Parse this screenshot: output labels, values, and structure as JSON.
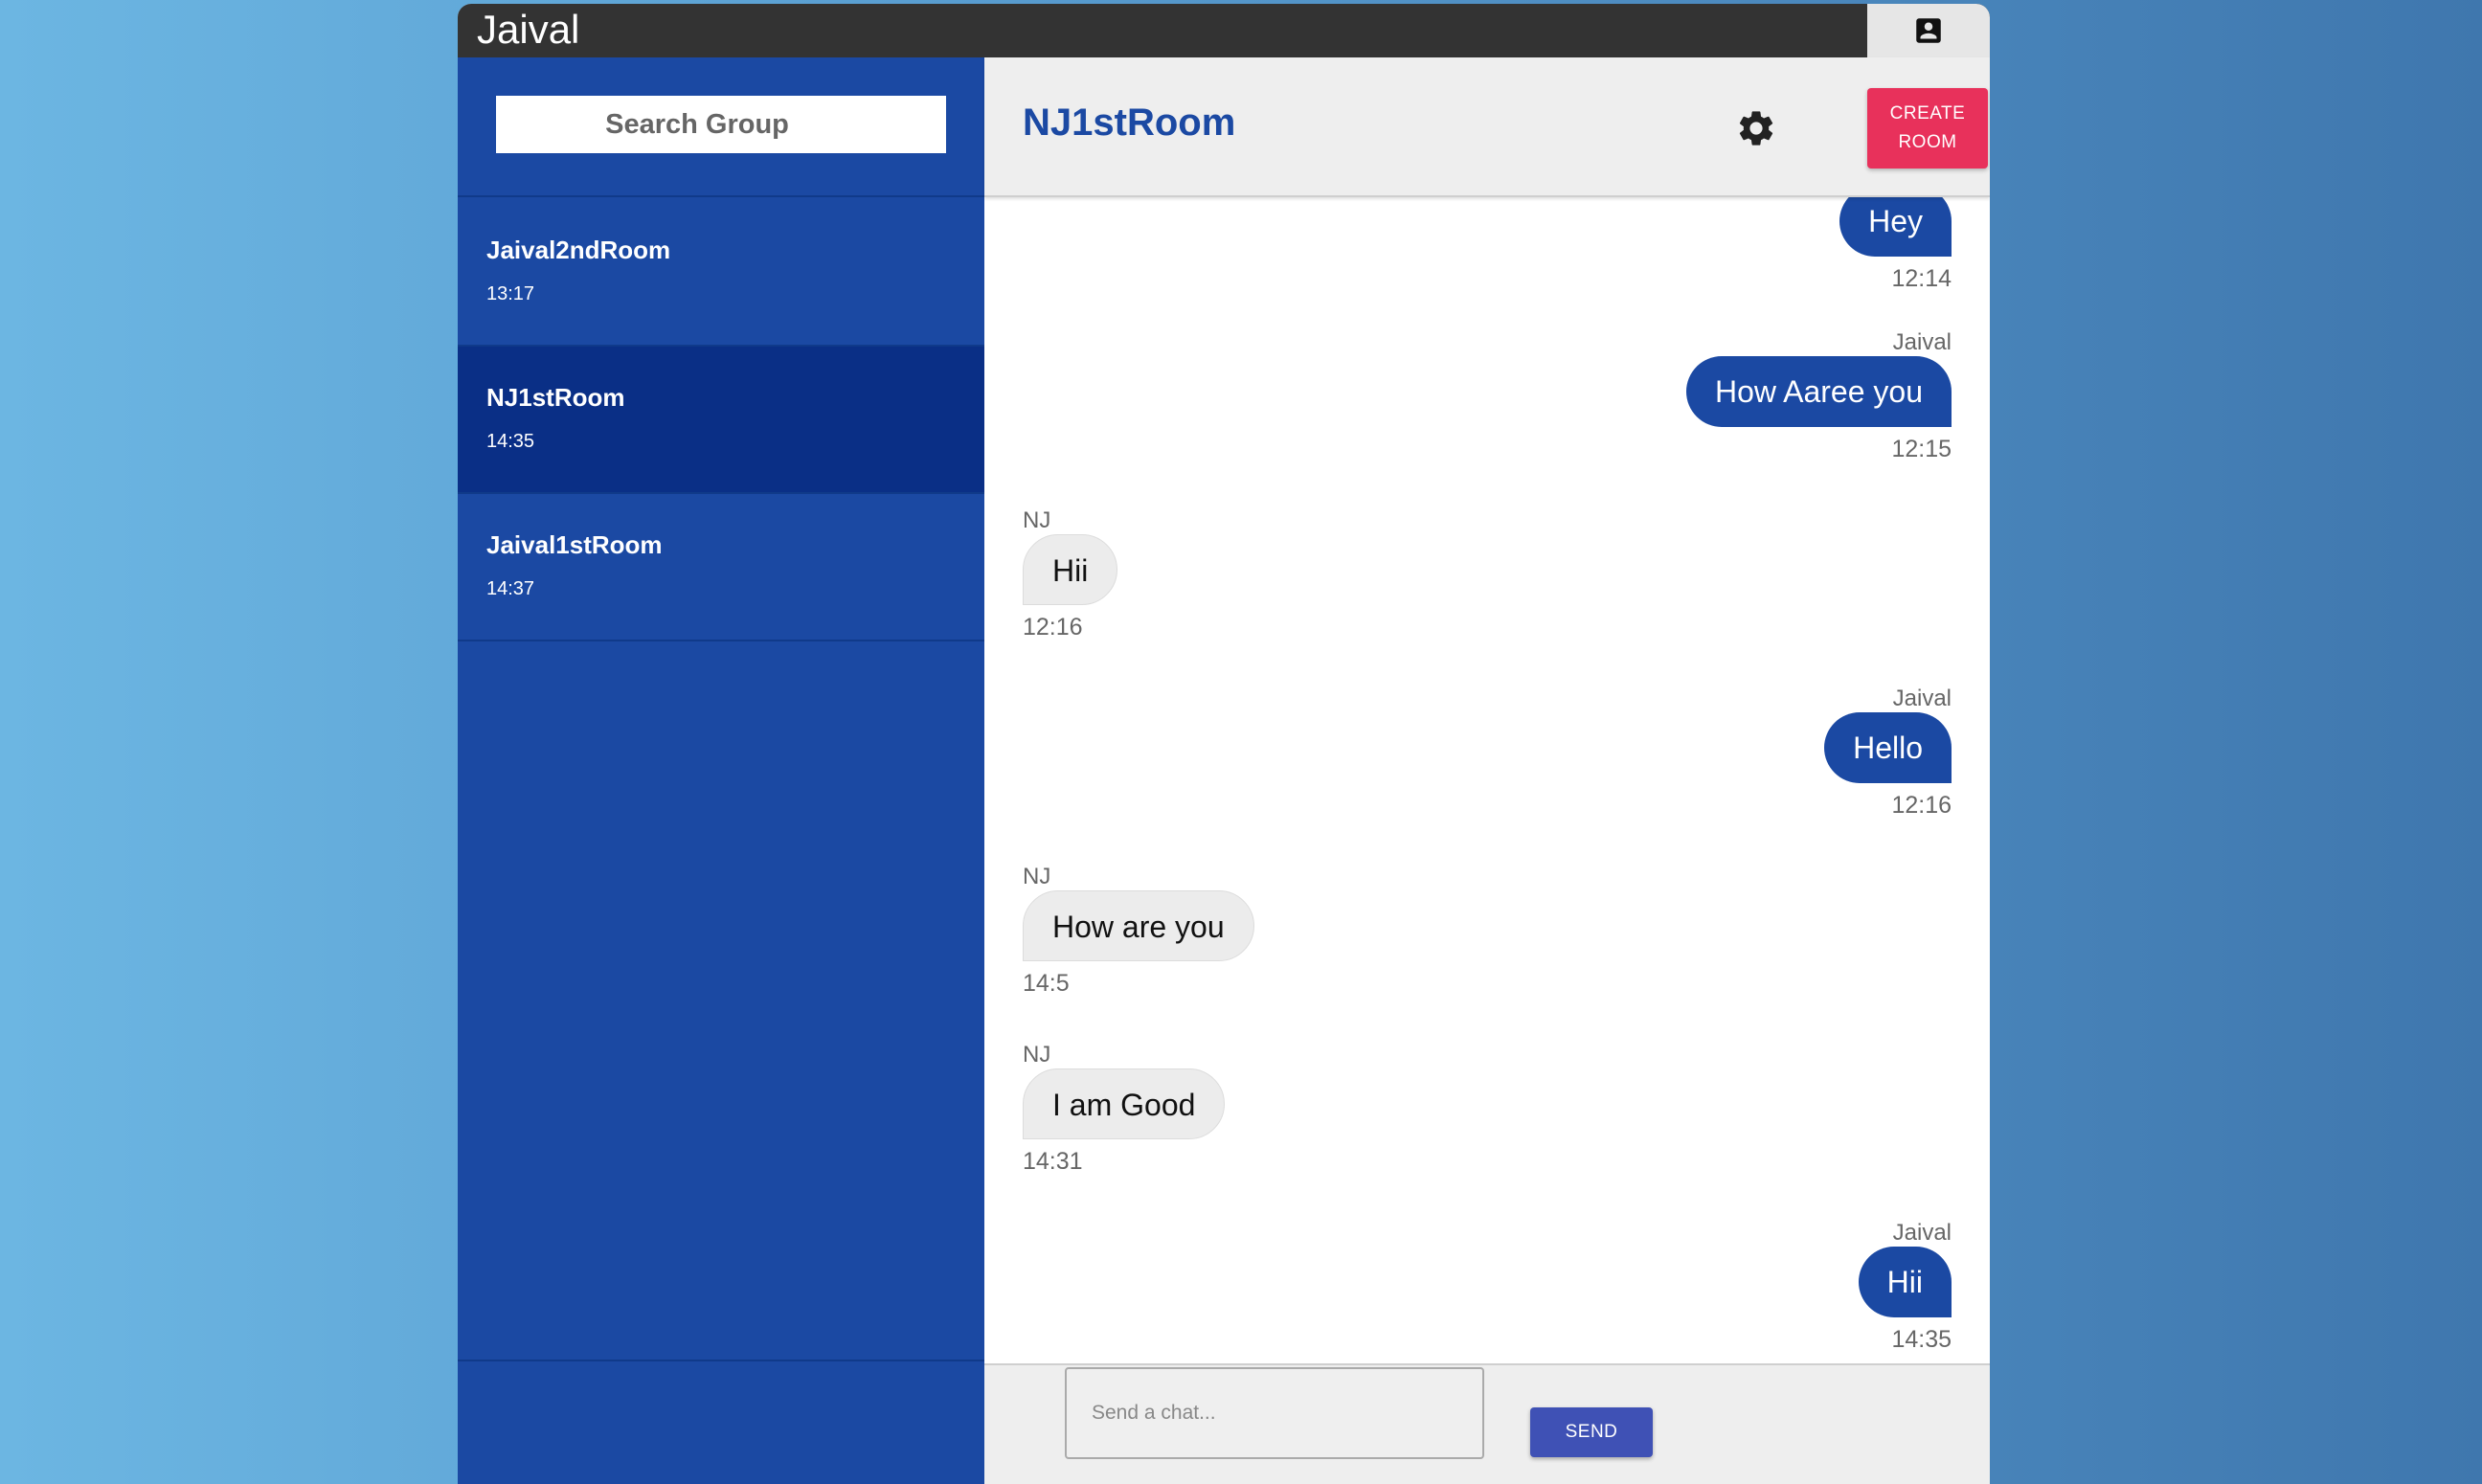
{
  "app": {
    "title": "Jaival"
  },
  "profile": {
    "icon": "account-box-icon"
  },
  "sidebar": {
    "search_placeholder": "Search Group",
    "rooms": [
      {
        "name": "Jaival2ndRoom",
        "time": "13:17",
        "active": false
      },
      {
        "name": "NJ1stRoom",
        "time": "14:35",
        "active": true
      },
      {
        "name": "Jaival1stRoom",
        "time": "14:37",
        "active": false
      }
    ]
  },
  "chat": {
    "room_title": "NJ1stRoom",
    "settings_icon": "gear-icon",
    "create_room_label": "CREATE ROOM",
    "messages": [
      {
        "sender": "",
        "text": "Hey",
        "time": "12:14",
        "side": "right"
      },
      {
        "sender": "Jaival",
        "text": "How Aaree you",
        "time": "12:15",
        "side": "right"
      },
      {
        "sender": "NJ",
        "text": "Hii",
        "time": "12:16",
        "side": "left"
      },
      {
        "sender": "Jaival",
        "text": "Hello",
        "time": "12:16",
        "side": "right"
      },
      {
        "sender": "NJ",
        "text": "How are you",
        "time": "14:5",
        "side": "left"
      },
      {
        "sender": "NJ",
        "text": "I am Good",
        "time": "14:31",
        "side": "left"
      },
      {
        "sender": "Jaival",
        "text": "Hii",
        "time": "14:35",
        "side": "right"
      }
    ],
    "input_placeholder": "Send a chat...",
    "send_label": "SEND"
  },
  "colors": {
    "primary": "#1b49a3",
    "active_room": "#0a2f86",
    "create_button": "#e8315b",
    "send_button": "#3f51b5",
    "topbar": "#333333"
  }
}
